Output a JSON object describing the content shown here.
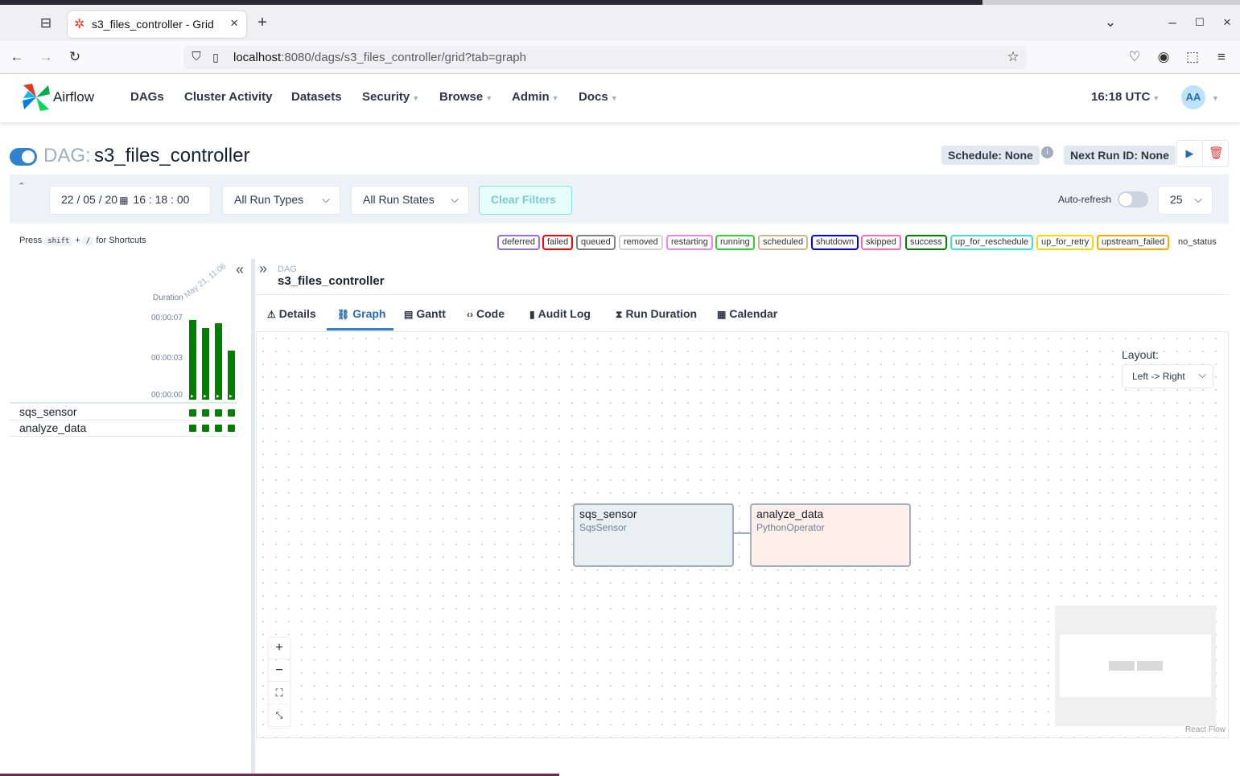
{
  "browser": {
    "tab_title": "s3_files_controller - Grid",
    "url_host": "localhost",
    "url_rest": ":8080/dags/s3_files_controller/grid?tab=graph"
  },
  "header": {
    "brand": "Airflow",
    "menu": [
      {
        "label": "DAGs",
        "dropdown": false
      },
      {
        "label": "Cluster Activity",
        "dropdown": false
      },
      {
        "label": "Datasets",
        "dropdown": false
      },
      {
        "label": "Security",
        "dropdown": true
      },
      {
        "label": "Browse",
        "dropdown": true
      },
      {
        "label": "Admin",
        "dropdown": true
      },
      {
        "label": "Docs",
        "dropdown": true
      }
    ],
    "time": "16:18 UTC",
    "avatar": "AA"
  },
  "dag": {
    "prefix": "DAG:",
    "name": "s3_files_controller",
    "schedule": "Schedule: None",
    "next_run": "Next Run ID: None"
  },
  "filters": {
    "date": "22 / 05 / 20",
    "time": "16 : 18 : 00",
    "run_types": "All Run Types",
    "run_states": "All Run States",
    "clear": "Clear Filters",
    "auto_refresh": "Auto-refresh",
    "page_size": "25"
  },
  "shortcuts": {
    "press": "Press",
    "key1": "shift",
    "plus": "+",
    "key2": "/",
    "suffix": "for Shortcuts"
  },
  "states": [
    {
      "label": "deferred",
      "color": "#9370db"
    },
    {
      "label": "failed",
      "color": "#ff0000"
    },
    {
      "label": "queued",
      "color": "#808080"
    },
    {
      "label": "removed",
      "color": "#d3d3d3"
    },
    {
      "label": "restarting",
      "color": "#ee82ee"
    },
    {
      "label": "running",
      "color": "#32cd32"
    },
    {
      "label": "scheduled",
      "color": "#d2b48c"
    },
    {
      "label": "shutdown",
      "color": "#0000ff"
    },
    {
      "label": "skipped",
      "color": "#ff69b4"
    },
    {
      "label": "success",
      "color": "#008000"
    },
    {
      "label": "up_for_reschedule",
      "color": "#40e0d0"
    },
    {
      "label": "up_for_retry",
      "color": "#ffd700"
    },
    {
      "label": "upstream_failed",
      "color": "#ffa500"
    },
    {
      "label": "no_status",
      "color": "#ffffff"
    }
  ],
  "grid": {
    "duration_label": "Duration",
    "date_label": "May 21, 11:06",
    "ticks": [
      "00:00:07",
      "00:00:03",
      "00:00:00"
    ],
    "run_durations_frac": [
      1.0,
      0.9,
      0.96,
      0.62
    ],
    "tasks": [
      "sqs_sensor",
      "analyze_data"
    ]
  },
  "details": {
    "breadcrumb_label": "DAG",
    "breadcrumb_name": "s3_files_controller",
    "tabs": [
      "Details",
      "Graph",
      "Gantt",
      "Code",
      "Audit Log",
      "Run Duration",
      "Calendar"
    ],
    "active_tab": "Graph"
  },
  "graph": {
    "layout_label": "Layout:",
    "layout_value": "Left -> Right",
    "nodes": [
      {
        "name": "sqs_sensor",
        "operator": "SqsSensor",
        "color": "#e8f0f2"
      },
      {
        "name": "analyze_data",
        "operator": "PythonOperator",
        "color": "#ffefeb"
      }
    ],
    "attribution": "React Flow"
  }
}
